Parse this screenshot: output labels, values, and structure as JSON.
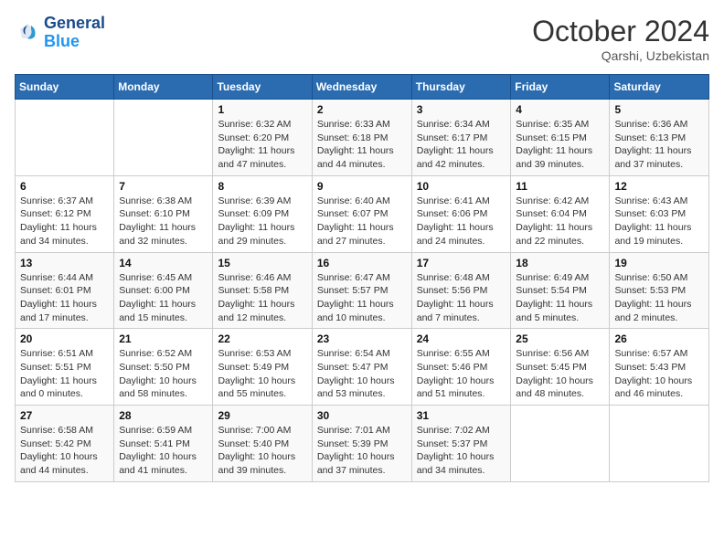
{
  "header": {
    "logo_line1": "General",
    "logo_line2": "Blue",
    "month": "October 2024",
    "location": "Qarshi, Uzbekistan"
  },
  "days_of_week": [
    "Sunday",
    "Monday",
    "Tuesday",
    "Wednesday",
    "Thursday",
    "Friday",
    "Saturday"
  ],
  "weeks": [
    [
      {
        "day": "",
        "sunrise": "",
        "sunset": "",
        "daylight": ""
      },
      {
        "day": "",
        "sunrise": "",
        "sunset": "",
        "daylight": ""
      },
      {
        "day": "1",
        "sunrise": "Sunrise: 6:32 AM",
        "sunset": "Sunset: 6:20 PM",
        "daylight": "Daylight: 11 hours and 47 minutes."
      },
      {
        "day": "2",
        "sunrise": "Sunrise: 6:33 AM",
        "sunset": "Sunset: 6:18 PM",
        "daylight": "Daylight: 11 hours and 44 minutes."
      },
      {
        "day": "3",
        "sunrise": "Sunrise: 6:34 AM",
        "sunset": "Sunset: 6:17 PM",
        "daylight": "Daylight: 11 hours and 42 minutes."
      },
      {
        "day": "4",
        "sunrise": "Sunrise: 6:35 AM",
        "sunset": "Sunset: 6:15 PM",
        "daylight": "Daylight: 11 hours and 39 minutes."
      },
      {
        "day": "5",
        "sunrise": "Sunrise: 6:36 AM",
        "sunset": "Sunset: 6:13 PM",
        "daylight": "Daylight: 11 hours and 37 minutes."
      }
    ],
    [
      {
        "day": "6",
        "sunrise": "Sunrise: 6:37 AM",
        "sunset": "Sunset: 6:12 PM",
        "daylight": "Daylight: 11 hours and 34 minutes."
      },
      {
        "day": "7",
        "sunrise": "Sunrise: 6:38 AM",
        "sunset": "Sunset: 6:10 PM",
        "daylight": "Daylight: 11 hours and 32 minutes."
      },
      {
        "day": "8",
        "sunrise": "Sunrise: 6:39 AM",
        "sunset": "Sunset: 6:09 PM",
        "daylight": "Daylight: 11 hours and 29 minutes."
      },
      {
        "day": "9",
        "sunrise": "Sunrise: 6:40 AM",
        "sunset": "Sunset: 6:07 PM",
        "daylight": "Daylight: 11 hours and 27 minutes."
      },
      {
        "day": "10",
        "sunrise": "Sunrise: 6:41 AM",
        "sunset": "Sunset: 6:06 PM",
        "daylight": "Daylight: 11 hours and 24 minutes."
      },
      {
        "day": "11",
        "sunrise": "Sunrise: 6:42 AM",
        "sunset": "Sunset: 6:04 PM",
        "daylight": "Daylight: 11 hours and 22 minutes."
      },
      {
        "day": "12",
        "sunrise": "Sunrise: 6:43 AM",
        "sunset": "Sunset: 6:03 PM",
        "daylight": "Daylight: 11 hours and 19 minutes."
      }
    ],
    [
      {
        "day": "13",
        "sunrise": "Sunrise: 6:44 AM",
        "sunset": "Sunset: 6:01 PM",
        "daylight": "Daylight: 11 hours and 17 minutes."
      },
      {
        "day": "14",
        "sunrise": "Sunrise: 6:45 AM",
        "sunset": "Sunset: 6:00 PM",
        "daylight": "Daylight: 11 hours and 15 minutes."
      },
      {
        "day": "15",
        "sunrise": "Sunrise: 6:46 AM",
        "sunset": "Sunset: 5:58 PM",
        "daylight": "Daylight: 11 hours and 12 minutes."
      },
      {
        "day": "16",
        "sunrise": "Sunrise: 6:47 AM",
        "sunset": "Sunset: 5:57 PM",
        "daylight": "Daylight: 11 hours and 10 minutes."
      },
      {
        "day": "17",
        "sunrise": "Sunrise: 6:48 AM",
        "sunset": "Sunset: 5:56 PM",
        "daylight": "Daylight: 11 hours and 7 minutes."
      },
      {
        "day": "18",
        "sunrise": "Sunrise: 6:49 AM",
        "sunset": "Sunset: 5:54 PM",
        "daylight": "Daylight: 11 hours and 5 minutes."
      },
      {
        "day": "19",
        "sunrise": "Sunrise: 6:50 AM",
        "sunset": "Sunset: 5:53 PM",
        "daylight": "Daylight: 11 hours and 2 minutes."
      }
    ],
    [
      {
        "day": "20",
        "sunrise": "Sunrise: 6:51 AM",
        "sunset": "Sunset: 5:51 PM",
        "daylight": "Daylight: 11 hours and 0 minutes."
      },
      {
        "day": "21",
        "sunrise": "Sunrise: 6:52 AM",
        "sunset": "Sunset: 5:50 PM",
        "daylight": "Daylight: 10 hours and 58 minutes."
      },
      {
        "day": "22",
        "sunrise": "Sunrise: 6:53 AM",
        "sunset": "Sunset: 5:49 PM",
        "daylight": "Daylight: 10 hours and 55 minutes."
      },
      {
        "day": "23",
        "sunrise": "Sunrise: 6:54 AM",
        "sunset": "Sunset: 5:47 PM",
        "daylight": "Daylight: 10 hours and 53 minutes."
      },
      {
        "day": "24",
        "sunrise": "Sunrise: 6:55 AM",
        "sunset": "Sunset: 5:46 PM",
        "daylight": "Daylight: 10 hours and 51 minutes."
      },
      {
        "day": "25",
        "sunrise": "Sunrise: 6:56 AM",
        "sunset": "Sunset: 5:45 PM",
        "daylight": "Daylight: 10 hours and 48 minutes."
      },
      {
        "day": "26",
        "sunrise": "Sunrise: 6:57 AM",
        "sunset": "Sunset: 5:43 PM",
        "daylight": "Daylight: 10 hours and 46 minutes."
      }
    ],
    [
      {
        "day": "27",
        "sunrise": "Sunrise: 6:58 AM",
        "sunset": "Sunset: 5:42 PM",
        "daylight": "Daylight: 10 hours and 44 minutes."
      },
      {
        "day": "28",
        "sunrise": "Sunrise: 6:59 AM",
        "sunset": "Sunset: 5:41 PM",
        "daylight": "Daylight: 10 hours and 41 minutes."
      },
      {
        "day": "29",
        "sunrise": "Sunrise: 7:00 AM",
        "sunset": "Sunset: 5:40 PM",
        "daylight": "Daylight: 10 hours and 39 minutes."
      },
      {
        "day": "30",
        "sunrise": "Sunrise: 7:01 AM",
        "sunset": "Sunset: 5:39 PM",
        "daylight": "Daylight: 10 hours and 37 minutes."
      },
      {
        "day": "31",
        "sunrise": "Sunrise: 7:02 AM",
        "sunset": "Sunset: 5:37 PM",
        "daylight": "Daylight: 10 hours and 34 minutes."
      },
      {
        "day": "",
        "sunrise": "",
        "sunset": "",
        "daylight": ""
      },
      {
        "day": "",
        "sunrise": "",
        "sunset": "",
        "daylight": ""
      }
    ]
  ]
}
